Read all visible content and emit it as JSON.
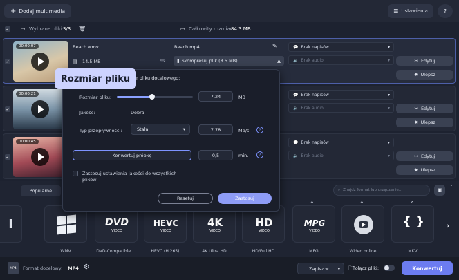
{
  "toolbar": {
    "add_media": "Dodaj multimedia",
    "settings": "Ustawienia",
    "help": "?"
  },
  "subbar": {
    "selected_label": "Wybrane pliki:",
    "selected_count": "3/3",
    "total_size_label": "Całkowity rozmiar:",
    "total_size": "84.3 MB"
  },
  "files": [
    {
      "duration": "00:00:07",
      "name": "Beach.wmv",
      "size": "14.5 MB",
      "output_name": "Beach.mp4",
      "compress": "Skompresuj plik (8.5 MB)",
      "subtitles": "Brak napisów",
      "audio": "Brak audio",
      "edit": "Edytuj",
      "enhance": "Ulepsz"
    },
    {
      "duration": "00:00:21",
      "subtitles": "Brak napisów",
      "audio": "Brak audio",
      "edit": "Edytuj",
      "enhance": "Ulepsz"
    },
    {
      "duration": "00:00:45",
      "subtitles": "Brak napisów",
      "audio": "Brak audio",
      "edit": "Edytuj",
      "enhance": "Ulepsz"
    }
  ],
  "tooltip": "Rozmiar pliku",
  "popup": {
    "heading_partial": "r pliku docelowego:",
    "size_label": "Rozmiar pliku:",
    "size_value": "7,24",
    "size_unit": "MB",
    "slider_fraction": 0.46,
    "quality_label": "Jakość:",
    "quality_value": "Dobra",
    "bitrate_label": "Typ przepływności:",
    "bitrate_type": "Stała",
    "bitrate_value": "7,78",
    "bitrate_unit": "Mb/s",
    "sample_button": "Konwertuj próbkę",
    "sample_value": "0,5",
    "sample_unit": "min.",
    "apply_all": "Zastosuj ustawienia jakości do wszystkich plików",
    "reset": "Resetuj",
    "apply": "Zastosuj"
  },
  "formats": {
    "tab_popular": "Popularne",
    "search_placeholder": "Znajdź format lub urządzenie...",
    "tiles": [
      {
        "label": "WMV",
        "logo": "windows"
      },
      {
        "label": "DVD-Compatible ...",
        "logo": "DVD"
      },
      {
        "label": "HEVC (H.265)",
        "logo": "HEVC"
      },
      {
        "label": "4K Ultra HD",
        "logo": "4K"
      },
      {
        "label": "HD/Full HD",
        "logo": "HD"
      },
      {
        "label": "MPG",
        "logo": "MPG"
      },
      {
        "label": "Wideo online",
        "logo": "youtube"
      },
      {
        "label": "MKV",
        "logo": "{ }"
      }
    ]
  },
  "footer": {
    "format_label": "Format docelowy:",
    "format_value": "MP4",
    "save_to": "Zapisz w...",
    "merge_label": "Połącz pliki:",
    "convert": "Konwertuj"
  }
}
